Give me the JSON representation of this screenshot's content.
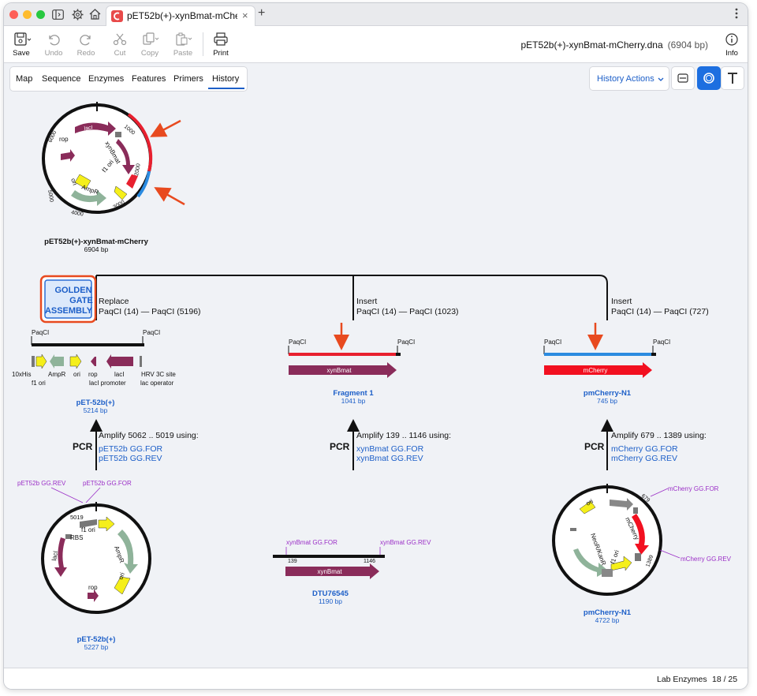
{
  "window": {
    "tab_title": "pET52b(+)-xynBmat-mCherry",
    "tab_title_display": "pET52b(+)-xynBmat-mCherr",
    "filename": "pET52b(+)-xynBmat-mCherry.dna",
    "filesize": "(6904 bp)"
  },
  "toolbar": {
    "save": "Save",
    "undo": "Undo",
    "redo": "Redo",
    "cut": "Cut",
    "copy": "Copy",
    "paste": "Paste",
    "print": "Print",
    "info": "Info"
  },
  "view_tabs": [
    "Map",
    "Sequence",
    "Enzymes",
    "Features",
    "Primers",
    "History"
  ],
  "active_tab": "History",
  "history_actions": "History Actions",
  "colors": {
    "accent": "#1d5fc8",
    "maroon": "#8a2c5a",
    "red": "#e8202f",
    "blue": "#2b8be0",
    "yellow": "#f5ef1a",
    "green": "#8fb39a",
    "orange_arrow": "#e84a1f",
    "purple_label": "#9b2fc7"
  },
  "final_product": {
    "name": "pET52b(+)-xynBmat-mCherry",
    "size": "6904 bp",
    "features": [
      "lacI",
      "rop",
      "ori",
      "AmpR",
      "f1 ori",
      "xynBmat"
    ],
    "ticks": [
      "1000",
      "2000",
      "3000",
      "4000",
      "5000",
      "6000"
    ]
  },
  "assembly": {
    "method_line1": "Golden",
    "method_line2": "Gate",
    "method_line3": "Assembly",
    "branches": [
      {
        "action": "Replace",
        "sites": "PaqCI (14)  —  PaqCI (5196)"
      },
      {
        "action": "Insert",
        "sites": "PaqCI (14)  —  PaqCI (1023)"
      },
      {
        "action": "Insert",
        "sites": "PaqCI (14)  —  PaqCI (727)"
      }
    ]
  },
  "fragments": [
    {
      "name": "pET-52b(+)",
      "size": "5214 bp",
      "site_left": "PaqCI",
      "site_right": "PaqCI",
      "features_row1": [
        "10xHis",
        "AmpR",
        "ori",
        "rop",
        "lacI",
        "HRV 3C site"
      ],
      "features_row2": [
        "f1 ori",
        "lacI promoter",
        "lac operator"
      ]
    },
    {
      "name": "Fragment 1",
      "size": "1041 bp",
      "site_left": "PaqCI",
      "site_right": "PaqCI",
      "feature": "xynBmat"
    },
    {
      "name": "pmCherry-N1",
      "size": "745 bp",
      "site_left": "PaqCI",
      "site_right": "PaqCI",
      "feature": "mCherry"
    }
  ],
  "pcr": [
    {
      "label": "PCR",
      "amplify": "Amplify 5062 .. 5019 using:",
      "primer1": "pET52b GG.FOR",
      "primer2": "pET52b GG.REV"
    },
    {
      "label": "PCR",
      "amplify": "Amplify 139 .. 1146 using:",
      "primer1": "xynBmat GG.FOR",
      "primer2": "xynBmat GG.REV"
    },
    {
      "label": "PCR",
      "amplify": "Amplify 679 .. 1389 using:",
      "primer1": "mCherry GG.FOR",
      "primer2": "mCherry GG.REV"
    }
  ],
  "templates": [
    {
      "name": "pET-52b(+)",
      "size": "5227 bp",
      "primer_rev": "pET52b GG.REV",
      "primer_for": "pET52b GG.FOR",
      "tick": "5019",
      "features": [
        "lacI",
        "RBS",
        "f1 ori",
        "AmpR",
        "ori",
        "rop"
      ]
    },
    {
      "name": "DTU76545",
      "size": "1190 bp",
      "primer_for": "xynBmat GG.FOR",
      "primer_rev": "xynBmat GG.REV",
      "pos_left": "139",
      "pos_right": "1146",
      "feature": "xynBmat"
    },
    {
      "name": "pmCherry-N1",
      "size": "4722 bp",
      "primer_for": "mCherry GG.FOR",
      "primer_rev": "mCherry GG.REV",
      "tick_top": "679",
      "tick_bottom": "1389",
      "features": [
        "ori",
        "mCherry",
        "NeoR/KanR",
        "f1 ori"
      ]
    }
  ],
  "status": {
    "enzymes": "Lab Enzymes",
    "count": "18 / 25"
  }
}
